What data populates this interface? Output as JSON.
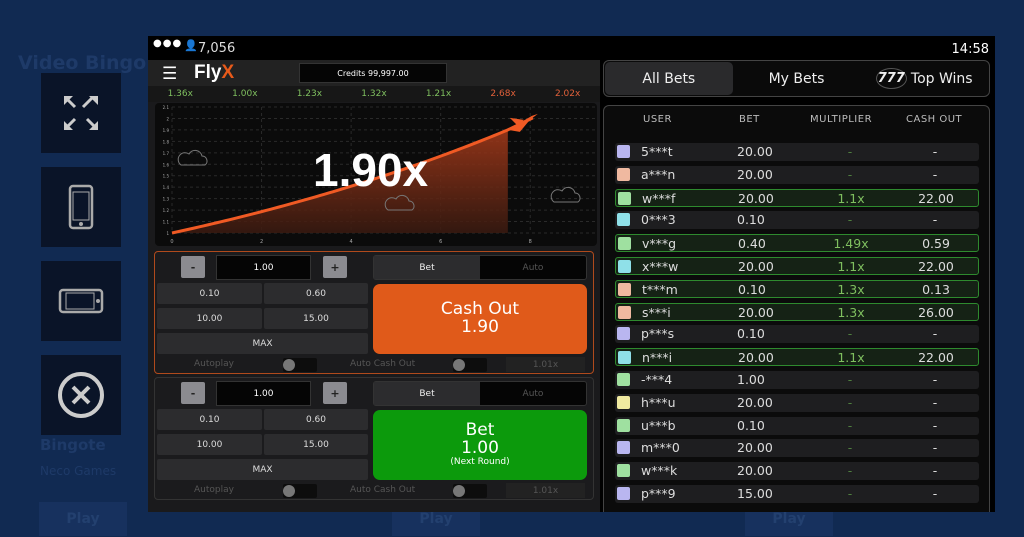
{
  "background": {
    "title": "Video Bingo. G",
    "game_name": "Bingote",
    "provider": "Neco Games",
    "play_label": "Play"
  },
  "side_buttons": [
    {
      "icon": "fullscreen-icon"
    },
    {
      "icon": "portrait-phone-icon"
    },
    {
      "icon": "landscape-phone-icon"
    },
    {
      "icon": "close-circle-icon"
    }
  ],
  "topbar": {
    "players": "7,056",
    "time": "14:58"
  },
  "header": {
    "logo": "FlyX",
    "credits": "Credits 99,997.00"
  },
  "history": [
    {
      "v": "1.36x",
      "c": "#7fbf5f"
    },
    {
      "v": "1.00x",
      "c": "#7fbf5f"
    },
    {
      "v": "1.23x",
      "c": "#7fbf5f"
    },
    {
      "v": "1.32x",
      "c": "#7fbf5f"
    },
    {
      "v": "1.21x",
      "c": "#7fbf5f"
    },
    {
      "v": "2.68x",
      "c": "#e0603a"
    },
    {
      "v": "2.02x",
      "c": "#e0603a"
    }
  ],
  "chart": {
    "multiplier": "1.90x",
    "y_ticks": [
      "1",
      "1.1",
      "1.2",
      "1.3",
      "1.4",
      "1.5",
      "1.6",
      "1.7",
      "1.8",
      "1.9",
      "2",
      "2.1"
    ],
    "x_ticks": [
      "0",
      "2",
      "4",
      "6",
      "8"
    ],
    "current_time": 7.5,
    "current_value": 1.9
  },
  "panels": [
    {
      "amount": "1.00",
      "minus": "-",
      "plus": "+",
      "quick": [
        "0.10",
        "0.60",
        "10.00",
        "15.00"
      ],
      "max": "MAX",
      "tab_bet": "Bet",
      "tab_auto": "Auto",
      "action_title": "Cash Out",
      "action_value": "1.90",
      "action_note": "",
      "action_color": "#e05a1a",
      "autoplay": "Autoplay",
      "auto_cash_out": "Auto Cash Out",
      "auto_cash_value": "1.01x"
    },
    {
      "amount": "1.00",
      "minus": "-",
      "plus": "+",
      "quick": [
        "0.10",
        "0.60",
        "10.00",
        "15.00"
      ],
      "max": "MAX",
      "tab_bet": "Bet",
      "tab_auto": "Auto",
      "action_title": "Bet",
      "action_value": "1.00",
      "action_note": "(Next Round)",
      "action_color": "#0c9a0c",
      "autoplay": "Autoplay",
      "auto_cash_out": "Auto Cash Out",
      "auto_cash_value": "1.01x"
    }
  ],
  "bets_tabs": {
    "all": "All Bets",
    "my": "My Bets",
    "top": "Top Wins",
    "top_badge": "777"
  },
  "table": {
    "headers": [
      "USER",
      "BET",
      "MULTIPLIER",
      "CASH OUT"
    ],
    "rows": [
      {
        "user": "5***t",
        "bet": "20.00",
        "mult": "-",
        "cash": "-",
        "win": false,
        "av": "#b9b6f0"
      },
      {
        "user": "a***n",
        "bet": "20.00",
        "mult": "-",
        "cash": "-",
        "win": false,
        "av": "#f0b9a0"
      },
      {
        "user": "w***f",
        "bet": "20.00",
        "mult": "1.1x",
        "cash": "22.00",
        "win": true,
        "av": "#9fe0a0"
      },
      {
        "user": "0***3",
        "bet": "0.10",
        "mult": "-",
        "cash": "-",
        "win": false,
        "av": "#8fe0e8"
      },
      {
        "user": "v***g",
        "bet": "0.40",
        "mult": "1.49x",
        "cash": "0.59",
        "win": true,
        "av": "#9fe0a0"
      },
      {
        "user": "x***w",
        "bet": "20.00",
        "mult": "1.1x",
        "cash": "22.00",
        "win": true,
        "av": "#8fe0e8"
      },
      {
        "user": "t***m",
        "bet": "0.10",
        "mult": "1.3x",
        "cash": "0.13",
        "win": true,
        "av": "#f0b9a0"
      },
      {
        "user": "s***i",
        "bet": "20.00",
        "mult": "1.3x",
        "cash": "26.00",
        "win": true,
        "av": "#f0b9a0"
      },
      {
        "user": "p***s",
        "bet": "0.10",
        "mult": "-",
        "cash": "-",
        "win": false,
        "av": "#b9b6f0"
      },
      {
        "user": "n***i",
        "bet": "20.00",
        "mult": "1.1x",
        "cash": "22.00",
        "win": true,
        "av": "#8fe0e8"
      },
      {
        "user": "-***4",
        "bet": "1.00",
        "mult": "-",
        "cash": "-",
        "win": false,
        "av": "#9fe0a0"
      },
      {
        "user": "h***u",
        "bet": "20.00",
        "mult": "-",
        "cash": "-",
        "win": false,
        "av": "#f0eaa0"
      },
      {
        "user": "u***b",
        "bet": "0.10",
        "mult": "-",
        "cash": "-",
        "win": false,
        "av": "#9fe0a0"
      },
      {
        "user": "m***0",
        "bet": "20.00",
        "mult": "-",
        "cash": "-",
        "win": false,
        "av": "#b9b6f0"
      },
      {
        "user": "w***k",
        "bet": "20.00",
        "mult": "-",
        "cash": "-",
        "win": false,
        "av": "#9fe0a0"
      },
      {
        "user": "p***9",
        "bet": "15.00",
        "mult": "-",
        "cash": "-",
        "win": false,
        "av": "#b9b6f0"
      }
    ]
  }
}
